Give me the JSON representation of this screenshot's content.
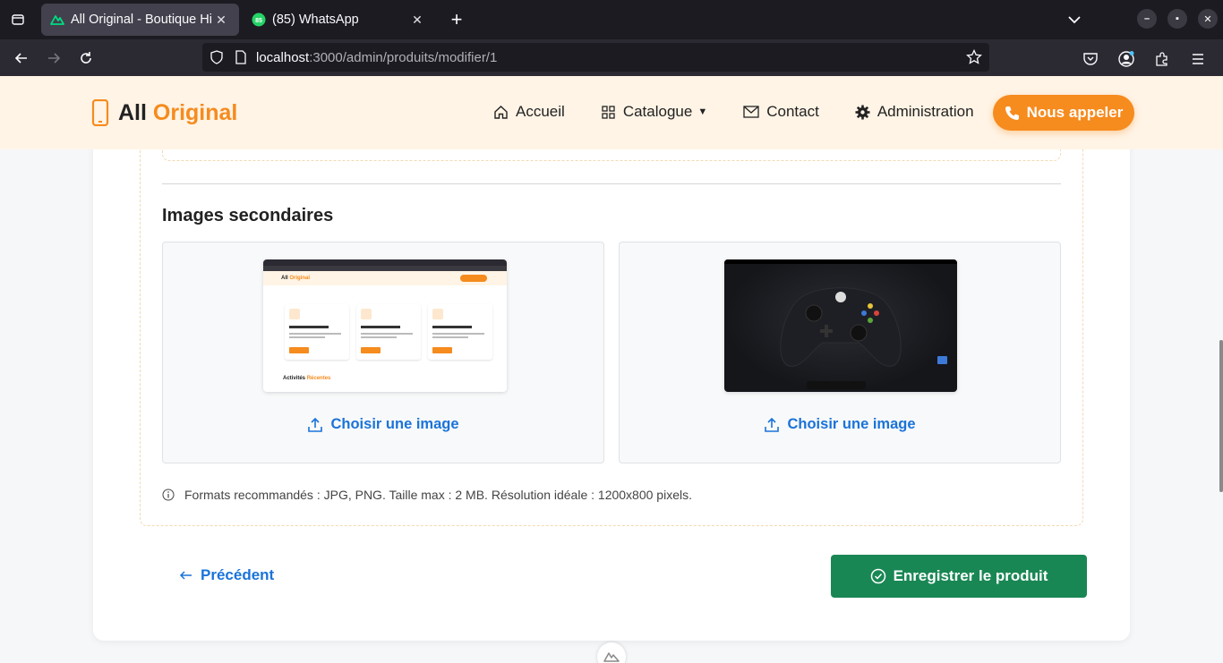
{
  "browser": {
    "tabs": [
      {
        "title": "All Original - Boutique Hig",
        "active": true,
        "icon": "nuxt-icon"
      },
      {
        "title": "(85) WhatsApp",
        "active": false,
        "icon": "whatsapp-icon",
        "badge": "85"
      }
    ],
    "url_host": "localhost",
    "url_rest": ":3000/admin/produits/modifier/1"
  },
  "site": {
    "logo_word1": "All",
    "logo_word2": "Original",
    "menu": [
      {
        "label": "Accueil",
        "icon": "home-icon"
      },
      {
        "label": "Catalogue",
        "icon": "grid-icon"
      },
      {
        "label": "Contact",
        "icon": "envelope-icon"
      },
      {
        "label": "Administration",
        "icon": "gear-icon"
      }
    ],
    "call_label": "Nous appeler",
    "accent": "#f68b1e"
  },
  "form": {
    "section_title": "Images secondaires",
    "choose_label": "Choisir une image",
    "hint": "Formats recommandés : JPG, PNG. Taille max : 2 MB. Résolution idéale : 1200x800 pixels.",
    "prev_label": "Précédent",
    "save_label": "Enregistrer le produit",
    "save_color": "#198754",
    "link_color": "#1a73d9"
  },
  "thumb1": {
    "logo_word1": "All",
    "logo_word2": "Original",
    "activity_word1": "Activités",
    "activity_word2": "Récentes"
  }
}
